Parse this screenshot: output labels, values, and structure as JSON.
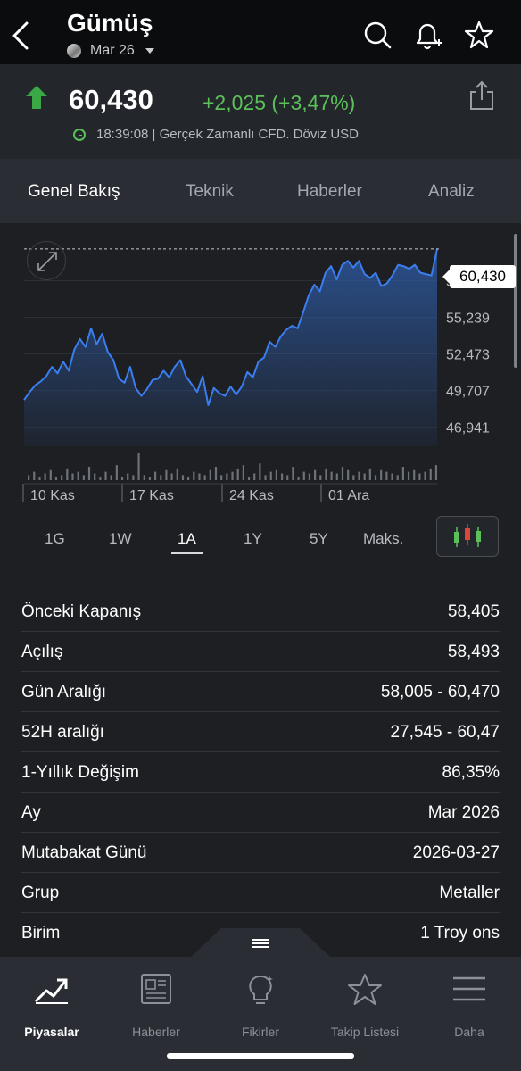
{
  "header": {
    "title": "Gümüş",
    "contract": "Mar 26"
  },
  "quote": {
    "price": "60,430",
    "change": "+2,025 (+3,47%)",
    "meta": "18:39:08 | Gerçek Zamanlı CFD. Döviz USD",
    "direction": "up",
    "colors": {
      "up": "#5cc05a",
      "accent": "#2e7cf6"
    }
  },
  "tabs": [
    {
      "label": "Genel Bakış",
      "active": true
    },
    {
      "label": "Teknik"
    },
    {
      "label": "Haberler"
    },
    {
      "label": "Analiz"
    }
  ],
  "chart_data": {
    "type": "area",
    "current_label": "60,430",
    "yticks": [
      "58,005",
      "55,239",
      "52,473",
      "49,707",
      "46,941"
    ],
    "ylim": [
      45.5,
      61.0
    ],
    "xticks": [
      "10 Kas",
      "17 Kas",
      "24 Kas",
      "01 Ara"
    ],
    "values": [
      49.0,
      49.6,
      50.1,
      50.4,
      50.8,
      51.5,
      51.0,
      51.9,
      51.2,
      52.8,
      53.6,
      53.0,
      54.4,
      53.2,
      54.0,
      52.6,
      52.0,
      50.6,
      50.3,
      51.5,
      49.9,
      49.3,
      49.8,
      50.5,
      50.6,
      51.2,
      50.7,
      51.5,
      52.0,
      50.8,
      50.2,
      49.6,
      50.8,
      48.6,
      49.9,
      49.5,
      49.3,
      50.0,
      49.4,
      50.0,
      51.1,
      50.7,
      51.9,
      52.2,
      53.4,
      53.0,
      53.8,
      54.3,
      54.6,
      54.4,
      55.6,
      56.9,
      57.7,
      57.2,
      58.6,
      59.1,
      58.1,
      59.2,
      59.5,
      59.0,
      59.5,
      58.5,
      58.2,
      58.6,
      57.6,
      57.8,
      58.4,
      59.2,
      59.1,
      58.9,
      59.2,
      58.6,
      58.5,
      58.4,
      60.4
    ],
    "volumes": [
      3,
      5,
      2,
      4,
      6,
      2,
      3,
      7,
      4,
      5,
      3,
      8,
      4,
      2,
      5,
      3,
      9,
      2,
      4,
      3,
      16,
      3,
      2,
      5,
      3,
      6,
      4,
      7,
      3,
      2,
      5,
      4,
      3,
      6,
      8,
      3,
      4,
      5,
      7,
      9,
      2,
      4,
      10,
      3,
      5,
      6,
      4,
      3,
      8,
      2,
      5,
      4,
      6,
      3,
      7,
      5,
      4,
      8,
      6,
      3,
      5,
      4,
      7,
      3,
      6,
      5,
      4,
      3,
      8,
      5,
      6,
      4,
      5,
      7,
      9
    ],
    "grid": true
  },
  "ranges": {
    "items": [
      "1G",
      "1W",
      "1A",
      "1Y",
      "5Y",
      "Maks."
    ],
    "selected": "1A"
  },
  "stats": [
    {
      "label": "Önceki Kapanış",
      "value": "58,405"
    },
    {
      "label": "Açılış",
      "value": "58,493"
    },
    {
      "label": "Gün Aralığı",
      "value": "58,005 - 60,470"
    },
    {
      "label": "52H aralığı",
      "value": "27,545 - 60,47"
    },
    {
      "label": "1-Yıllık Değişim",
      "value": "86,35%"
    },
    {
      "label": "Ay",
      "value": "Mar 2026"
    },
    {
      "label": "Mutabakat Günü",
      "value": "2026-03-27"
    },
    {
      "label": "Grup",
      "value": "Metaller"
    },
    {
      "label": "Birim",
      "value": "1 Troy ons"
    }
  ],
  "nav": [
    {
      "label": "Piyasalar",
      "icon": "chart-icon",
      "active": true
    },
    {
      "label": "Haberler",
      "icon": "news-icon"
    },
    {
      "label": "Fikirler",
      "icon": "lightbulb-icon"
    },
    {
      "label": "Takip Listesi",
      "icon": "star-icon"
    },
    {
      "label": "Daha",
      "icon": "menu-icon"
    }
  ]
}
